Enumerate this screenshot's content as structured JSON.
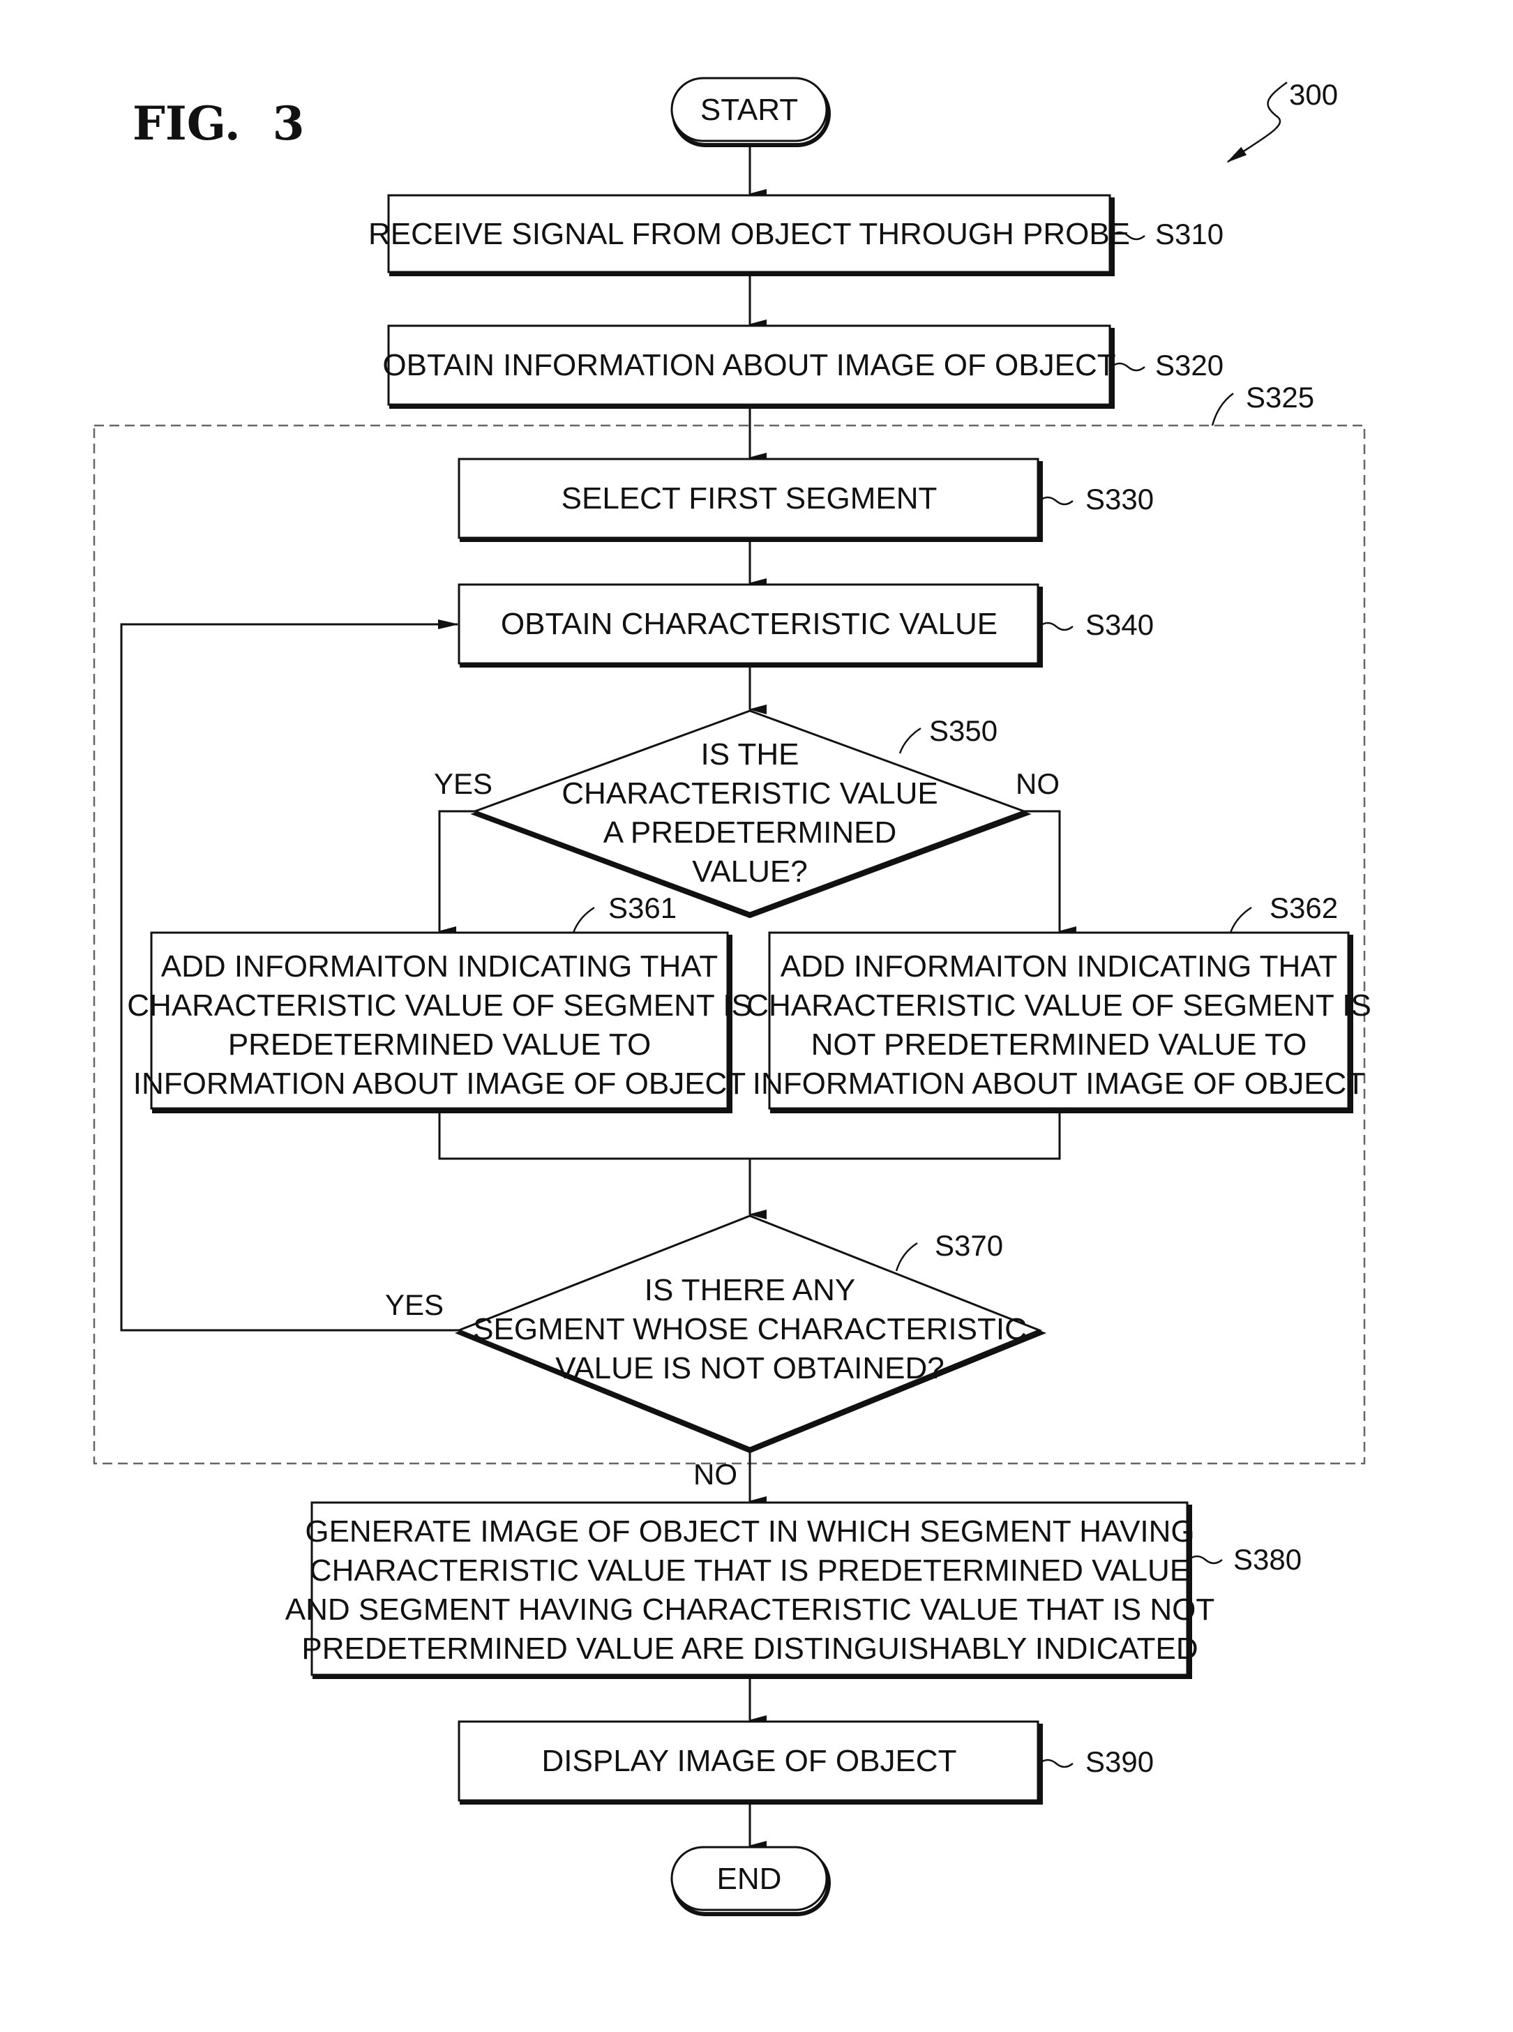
{
  "figure": {
    "title": "FIG.  3",
    "reference": "300"
  },
  "terminals": {
    "start": "START",
    "end": "END"
  },
  "group": {
    "label": "S325"
  },
  "steps": {
    "s310": {
      "label": "S310",
      "lines": [
        "RECEIVE SIGNAL FROM OBJECT THROUGH PROBE"
      ]
    },
    "s320": {
      "label": "S320",
      "lines": [
        "OBTAIN INFORMATION ABOUT IMAGE OF OBJECT"
      ]
    },
    "s330": {
      "label": "S330",
      "lines": [
        "SELECT FIRST SEGMENT"
      ]
    },
    "s340": {
      "label": "S340",
      "lines": [
        "OBTAIN CHARACTERISTIC VALUE"
      ]
    },
    "s350": {
      "label": "S350",
      "lines": [
        "IS THE",
        "CHARACTERISTIC VALUE",
        "A PREDETERMINED",
        "VALUE?"
      ],
      "yes": "YES",
      "no": "NO"
    },
    "s361": {
      "label": "S361",
      "lines": [
        "ADD INFORMAITON INDICATING THAT",
        "CHARACTERISTIC VALUE OF SEGMENT IS",
        "PREDETERMINED VALUE TO",
        "INFORMATION ABOUT IMAGE OF OBJECT"
      ]
    },
    "s362": {
      "label": "S362",
      "lines": [
        "ADD INFORMAITON INDICATING THAT",
        "CHARACTERISTIC VALUE OF SEGMENT IS",
        "NOT PREDETERMINED VALUE TO",
        "INFORMATION ABOUT IMAGE OF OBJECT"
      ]
    },
    "s370": {
      "label": "S370",
      "lines": [
        "IS THERE ANY",
        "SEGMENT WHOSE CHARACTERISTIC",
        "VALUE IS NOT OBTAINED?"
      ],
      "yes": "YES",
      "no": "NO"
    },
    "s380": {
      "label": "S380",
      "lines": [
        "GENERATE IMAGE OF OBJECT IN WHICH SEGMENT HAVING",
        "CHARACTERISTIC VALUE THAT IS PREDETERMINED VALUE",
        "AND SEGMENT HAVING CHARACTERISTIC VALUE THAT IS NOT",
        "PREDETERMINED VALUE ARE DISTINGUISHABLY INDICATED"
      ]
    },
    "s390": {
      "label": "S390",
      "lines": [
        "DISPLAY IMAGE OF OBJECT"
      ]
    }
  }
}
